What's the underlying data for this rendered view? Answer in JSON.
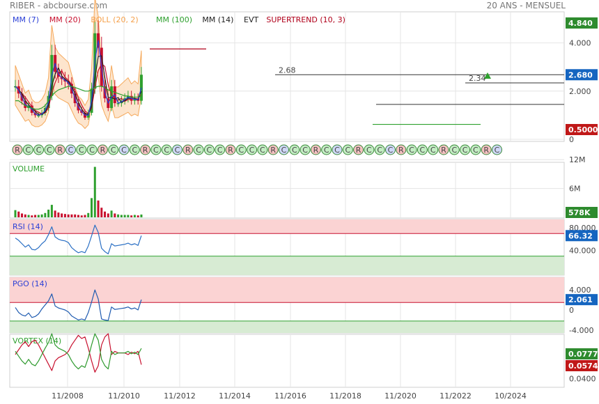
{
  "header": {
    "left": "RIBER - abcbourse.com",
    "right": "20 ANS - MENSUEL"
  },
  "colors": {
    "mm7": "#2a3fd6",
    "mm20": "#c8102e",
    "boll": "#f5a04a",
    "boll_fill": "#fde3c8",
    "mm100": "#2ea02e",
    "mm14": "#222222",
    "supertrend": "#b0001a",
    "rsi": "#2a6fc4",
    "pgo": "#1f5bb0",
    "vortex_pos": "#2e9a2e",
    "vortex_neg": "#c8102e",
    "zone_high": "#fbd3d3",
    "zone_low": "#d7ebd3",
    "grid": "#e4e4e4"
  },
  "chart_data": [
    {
      "type": "line",
      "panel": "price",
      "legend": [
        {
          "label": "MM (7)",
          "color": "#2a3fd6"
        },
        {
          "label": "MM (20)",
          "color": "#c8102e"
        },
        {
          "label": "BOLL (20, 2)",
          "color": "#f5a04a"
        },
        {
          "label": "MM (100)",
          "color": "#2ea02e"
        },
        {
          "label": "MM (14)",
          "color": "#222222"
        },
        {
          "label": "EVT",
          "color": "#222222"
        },
        {
          "label": "SUPERTREND (10, 3)",
          "color": "#b0001a"
        }
      ],
      "yticks": [
        "4.000",
        "2.000",
        "0"
      ],
      "badges": [
        {
          "value": "4.840",
          "color": "#2e8b2e"
        },
        {
          "value": "2.680",
          "color": "#1565c0"
        },
        {
          "value": "0.5000",
          "color": "#c01818"
        }
      ],
      "annotations": [
        "2.68",
        "2.34"
      ],
      "x": [
        "2005-01",
        "2005-07",
        "2006-01",
        "2006-07",
        "2007-01",
        "2007-07",
        "2008-01",
        "2008-07",
        "2009-01",
        "2009-07",
        "2010-01",
        "2010-07",
        "2011-01",
        "2011-07",
        "2012-01",
        "2012-07",
        "2013-01",
        "2013-07",
        "2014-01",
        "2014-07",
        "2015-01",
        "2015-07",
        "2016-01",
        "2016-07",
        "2017-01",
        "2017-07",
        "2018-01",
        "2018-07",
        "2019-01",
        "2019-07",
        "2020-01",
        "2020-07",
        "2021-01",
        "2021-07",
        "2022-01",
        "2022-07",
        "2023-01",
        "2023-07",
        "2024-01"
      ],
      "close": [
        2.2,
        1.9,
        1.6,
        1.3,
        1.4,
        1.1,
        1.0,
        1.0,
        1.1,
        1.3,
        1.8,
        3.5,
        2.8,
        2.6,
        2.5,
        2.4,
        2.3,
        1.9,
        1.5,
        1.2,
        1.1,
        0.9,
        1.1,
        2.1,
        4.4,
        3.8,
        2.2,
        1.7,
        1.3,
        2.2,
        1.5,
        1.5,
        1.6,
        1.7,
        1.8,
        1.6,
        1.7,
        1.6,
        2.68
      ],
      "mm100": [
        1.6,
        1.6,
        1.5,
        1.4,
        1.35,
        1.3,
        1.25,
        1.25,
        1.3,
        1.4,
        1.6,
        1.8,
        1.95,
        2.05,
        2.1,
        2.15,
        2.2,
        2.2,
        2.15,
        2.1,
        2.05,
        2.0,
        2.0,
        2.05,
        2.15,
        2.2,
        2.2,
        2.15,
        2.05,
        2.0,
        1.95,
        1.9,
        1.85,
        1.8,
        1.8,
        1.75,
        1.75,
        1.75,
        1.9
      ]
    },
    {
      "type": "bar",
      "panel": "volume",
      "title": "VOLUME",
      "yticks": [
        "12M",
        "6M"
      ],
      "badge": {
        "value": "578K",
        "color": "#2e8b2e"
      },
      "x": [
        "2005-01",
        "2005-07",
        "2006-01",
        "2006-07",
        "2007-01",
        "2007-07",
        "2008-01",
        "2008-07",
        "2009-01",
        "2009-07",
        "2010-01",
        "2010-07",
        "2011-01",
        "2011-07",
        "2012-01",
        "2012-07",
        "2013-01",
        "2013-07",
        "2014-01",
        "2014-07",
        "2015-01",
        "2015-07",
        "2016-01",
        "2016-07",
        "2017-01",
        "2017-07",
        "2018-01",
        "2018-07",
        "2019-01",
        "2019-07",
        "2020-01",
        "2020-07",
        "2021-01",
        "2021-07",
        "2022-01",
        "2022-07",
        "2023-01",
        "2023-07",
        "2024-01"
      ],
      "values": [
        1.5,
        1.2,
        0.8,
        0.6,
        0.5,
        0.4,
        0.5,
        0.5,
        0.6,
        0.9,
        1.6,
        2.6,
        1.4,
        1.0,
        0.8,
        0.7,
        0.6,
        0.6,
        0.6,
        0.5,
        0.4,
        0.5,
        0.9,
        4.0,
        10.5,
        3.5,
        2.0,
        1.2,
        0.8,
        1.4,
        0.8,
        0.6,
        0.5,
        0.5,
        0.5,
        0.4,
        0.5,
        0.4,
        0.58
      ]
    },
    {
      "type": "line",
      "panel": "rsi",
      "title": "RSI (14)",
      "yticks": [
        "80.000",
        "40.000"
      ],
      "badge": {
        "value": "66.32",
        "color": "#1565c0"
      },
      "ylim": [
        0,
        100
      ],
      "x": [
        "2005-01",
        "2005-07",
        "2006-01",
        "2006-07",
        "2007-01",
        "2007-07",
        "2008-01",
        "2008-07",
        "2009-01",
        "2009-07",
        "2010-01",
        "2010-07",
        "2011-01",
        "2011-07",
        "2012-01",
        "2012-07",
        "2013-01",
        "2013-07",
        "2014-01",
        "2014-07",
        "2015-01",
        "2015-07",
        "2016-01",
        "2016-07",
        "2017-01",
        "2017-07",
        "2018-01",
        "2018-07",
        "2019-01",
        "2019-07",
        "2020-01",
        "2020-07",
        "2021-01",
        "2021-07",
        "2022-01",
        "2022-07",
        "2023-01",
        "2023-07",
        "2024-01"
      ],
      "values": [
        62,
        58,
        52,
        46,
        50,
        42,
        41,
        45,
        52,
        57,
        68,
        82,
        64,
        60,
        58,
        57,
        54,
        45,
        40,
        36,
        38,
        36,
        48,
        66,
        85,
        72,
        44,
        38,
        34,
        52,
        48,
        49,
        50,
        51,
        53,
        50,
        52,
        49,
        66.32
      ]
    },
    {
      "type": "line",
      "panel": "pgo",
      "title": "PGO (14)",
      "yticks": [
        "4.000",
        "0",
        "-4.000"
      ],
      "badge": {
        "value": "2.061",
        "color": "#1565c0"
      },
      "ylim": [
        -6,
        6
      ],
      "x": [
        "2005-01",
        "2005-07",
        "2006-01",
        "2006-07",
        "2007-01",
        "2007-07",
        "2008-01",
        "2008-07",
        "2009-01",
        "2009-07",
        "2010-01",
        "2010-07",
        "2011-01",
        "2011-07",
        "2012-01",
        "2012-07",
        "2013-01",
        "2013-07",
        "2014-01",
        "2014-07",
        "2015-01",
        "2015-07",
        "2016-01",
        "2016-07",
        "2017-01",
        "2017-07",
        "2018-01",
        "2018-07",
        "2019-01",
        "2019-07",
        "2020-01",
        "2020-07",
        "2021-01",
        "2021-07",
        "2022-01",
        "2022-07",
        "2023-01",
        "2023-07",
        "2024-01"
      ],
      "values": [
        0.5,
        -0.5,
        -1.0,
        -1.2,
        -0.6,
        -1.5,
        -1.3,
        -0.8,
        0.2,
        1.0,
        1.8,
        3.2,
        0.8,
        0.4,
        0.2,
        0.0,
        -0.4,
        -1.2,
        -1.6,
        -2.0,
        -1.8,
        -2.0,
        -0.5,
        1.6,
        4.0,
        2.2,
        -1.8,
        -2.0,
        -2.1,
        0.6,
        0.1,
        0.2,
        0.3,
        0.4,
        0.6,
        0.2,
        0.4,
        0.0,
        2.061
      ]
    },
    {
      "type": "line",
      "panel": "vortex",
      "title": "VORTEX (14)",
      "yticks": [
        "0.0400"
      ],
      "badges": [
        {
          "value": "0.0777",
          "color": "#2e8b2e"
        },
        {
          "value": "0.0574",
          "color": "#c01818"
        }
      ],
      "x": [
        "2005-01",
        "2005-07",
        "2006-01",
        "2006-07",
        "2007-01",
        "2007-07",
        "2008-01",
        "2008-07",
        "2009-01",
        "2009-07",
        "2010-01",
        "2010-07",
        "2011-01",
        "2011-07",
        "2012-01",
        "2012-07",
        "2013-01",
        "2013-07",
        "2014-01",
        "2014-07",
        "2015-01",
        "2015-07",
        "2016-01",
        "2016-07",
        "2017-01",
        "2017-07",
        "2018-01",
        "2018-07",
        "2019-01",
        "2019-07",
        "2020-01",
        "2020-07",
        "2021-01",
        "2021-07",
        "2022-01",
        "2022-07",
        "2023-01",
        "2023-07",
        "2024-01"
      ],
      "series": [
        {
          "values": [
            0.074,
            0.068,
            0.062,
            0.058,
            0.064,
            0.058,
            0.056,
            0.062,
            0.07,
            0.078,
            0.085,
            0.096,
            0.082,
            0.078,
            0.076,
            0.074,
            0.07,
            0.062,
            0.056,
            0.052,
            0.056,
            0.054,
            0.066,
            0.082,
            0.096,
            0.088,
            0.064,
            0.056,
            0.052,
            0.074,
            0.07,
            0.072,
            0.072,
            0.072,
            0.074,
            0.071,
            0.073,
            0.07,
            0.0777
          ]
        },
        {
          "values": [
            0.07,
            0.076,
            0.082,
            0.086,
            0.08,
            0.086,
            0.088,
            0.082,
            0.074,
            0.066,
            0.058,
            0.05,
            0.062,
            0.066,
            0.068,
            0.07,
            0.074,
            0.082,
            0.088,
            0.094,
            0.09,
            0.092,
            0.078,
            0.062,
            0.048,
            0.056,
            0.082,
            0.092,
            0.096,
            0.07,
            0.074,
            0.072,
            0.072,
            0.072,
            0.07,
            0.073,
            0.071,
            0.074,
            0.0574
          ]
        }
      ]
    }
  ],
  "x_axis": {
    "ticks": [
      "11/2008",
      "11/2010",
      "11/2012",
      "11/2014",
      "11/2016",
      "11/2018",
      "11/2020",
      "11/2022",
      "10/2024"
    ]
  }
}
